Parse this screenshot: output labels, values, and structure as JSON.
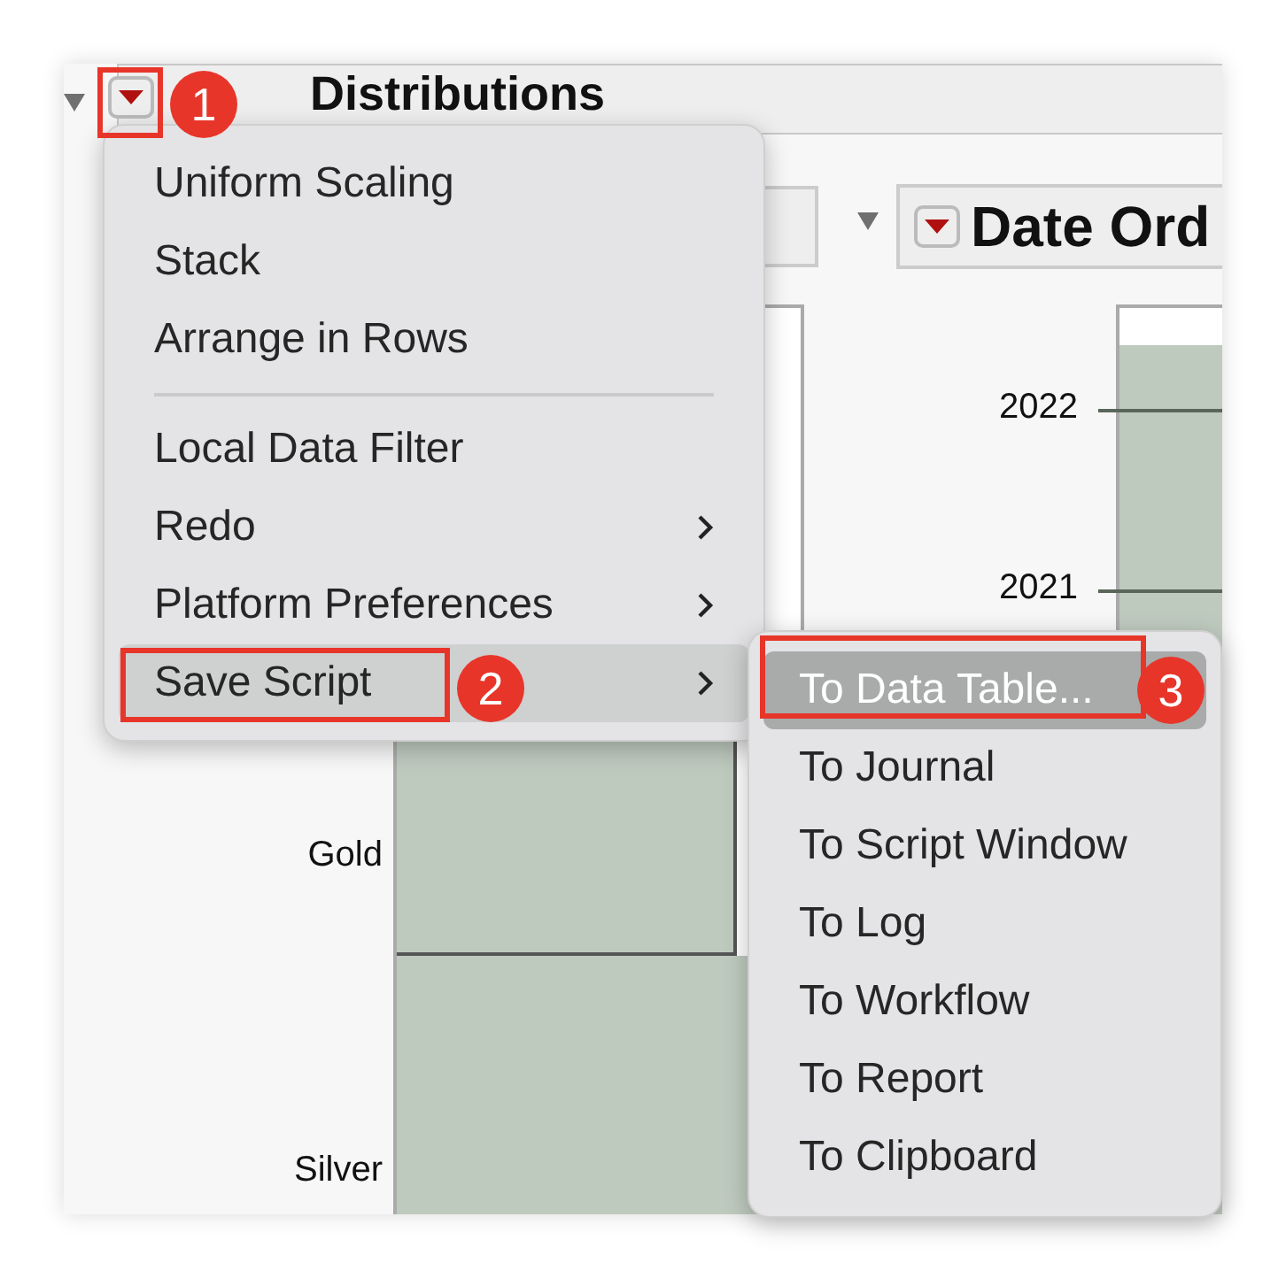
{
  "report": {
    "title": "Distributions",
    "panel_title": "Date Ord",
    "left_chart": {
      "axis_labels": [
        "Gold",
        "Silver"
      ]
    },
    "right_chart": {
      "axis_labels": [
        "2022",
        "2021"
      ]
    }
  },
  "menu": {
    "items": [
      {
        "kind": "item",
        "label": "Uniform Scaling",
        "submenu": false,
        "selected": false
      },
      {
        "kind": "item",
        "label": "Stack",
        "submenu": false,
        "selected": false
      },
      {
        "kind": "item",
        "label": "Arrange in Rows",
        "submenu": false,
        "selected": false
      },
      {
        "kind": "separator"
      },
      {
        "kind": "item",
        "label": "Local Data Filter",
        "submenu": false,
        "selected": false
      },
      {
        "kind": "item",
        "label": "Redo",
        "submenu": true,
        "selected": false
      },
      {
        "kind": "item",
        "label": "Platform Preferences",
        "submenu": true,
        "selected": false
      },
      {
        "kind": "item",
        "label": "Save Script",
        "submenu": true,
        "selected": true
      }
    ]
  },
  "submenu": {
    "items": [
      {
        "label": "To Data Table...",
        "selected": true
      },
      {
        "label": "To Journal",
        "selected": false
      },
      {
        "label": "To Script Window",
        "selected": false
      },
      {
        "label": "To Log",
        "selected": false
      },
      {
        "label": "To Workflow",
        "selected": false
      },
      {
        "label": "To Report",
        "selected": false
      },
      {
        "label": "To Clipboard",
        "selected": false
      }
    ]
  },
  "annotations": [
    {
      "number": "1"
    },
    {
      "number": "2"
    },
    {
      "number": "3"
    }
  ]
}
